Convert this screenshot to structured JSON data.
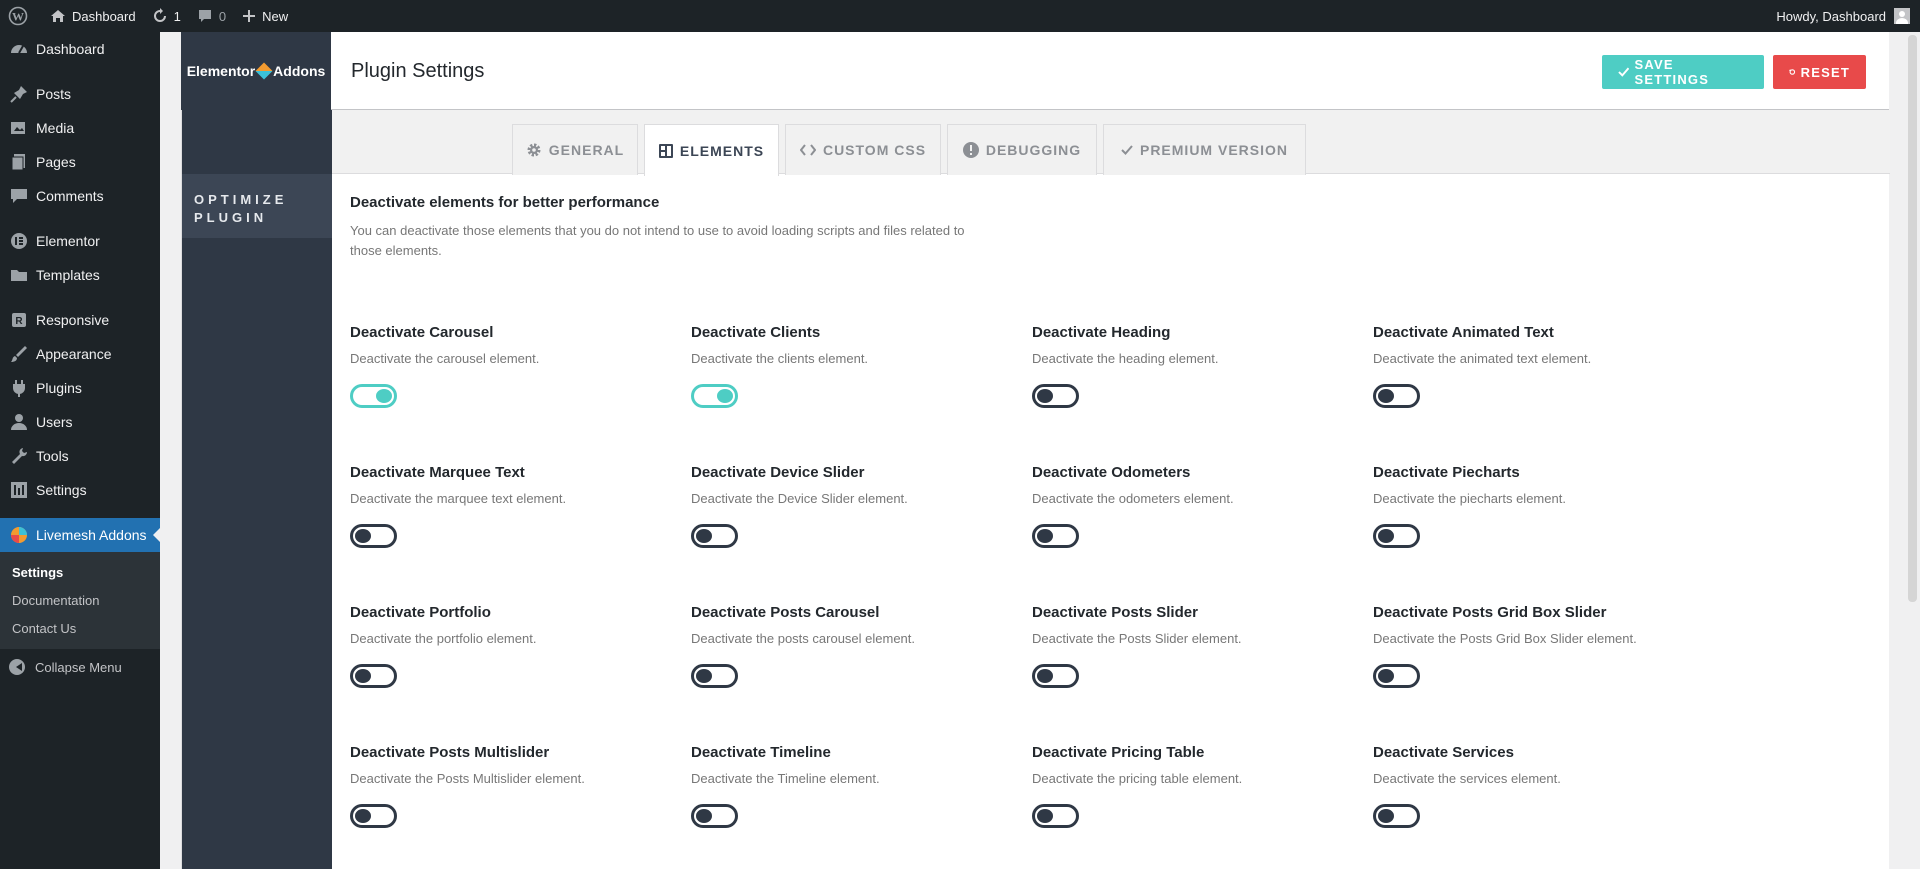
{
  "adminbar": {
    "site_name": "Dashboard",
    "updates_count": "1",
    "comments_count": "0",
    "new_label": "New",
    "howdy": "Howdy, Dashboard"
  },
  "menu": {
    "items": [
      {
        "label": "Dashboard",
        "icon": "dashboard-icon"
      },
      {
        "label": "Posts",
        "icon": "pin-icon"
      },
      {
        "label": "Media",
        "icon": "media-icon"
      },
      {
        "label": "Pages",
        "icon": "pages-icon"
      },
      {
        "label": "Comments",
        "icon": "comment-icon"
      },
      {
        "label": "Elementor",
        "icon": "elementor-icon"
      },
      {
        "label": "Templates",
        "icon": "folder-icon"
      },
      {
        "label": "Responsive",
        "icon": "responsive-icon"
      },
      {
        "label": "Appearance",
        "icon": "brush-icon"
      },
      {
        "label": "Plugins",
        "icon": "plug-icon"
      },
      {
        "label": "Users",
        "icon": "user-icon"
      },
      {
        "label": "Tools",
        "icon": "wrench-icon"
      },
      {
        "label": "Settings",
        "icon": "settings-icon"
      },
      {
        "label": "Livemesh Addons",
        "icon": "livemesh-icon"
      }
    ],
    "submenu": [
      "Settings",
      "Documentation",
      "Contact Us"
    ],
    "collapse": "Collapse Menu"
  },
  "header": {
    "logo_left": "Elementor",
    "logo_right": "Addons",
    "title": "Plugin Settings",
    "save_label": "SAVE SETTINGS",
    "reset_label": "RESET"
  },
  "sidebar": {
    "item_line1": "OPTIMIZE",
    "item_line2": "PLUGIN"
  },
  "tabs": [
    "GENERAL",
    "ELEMENTS",
    "CUSTOM CSS",
    "DEBUGGING",
    "PREMIUM VERSION"
  ],
  "section": {
    "title": "Deactivate elements for better performance",
    "desc": "You can deactivate those elements that you do not intend to use to avoid loading scripts and files related to those elements."
  },
  "elements": [
    {
      "title": "Deactivate Carousel",
      "desc": "Deactivate the carousel element.",
      "on": true
    },
    {
      "title": "Deactivate Clients",
      "desc": "Deactivate the clients element.",
      "on": true
    },
    {
      "title": "Deactivate Heading",
      "desc": "Deactivate the heading element.",
      "on": false
    },
    {
      "title": "Deactivate Animated Text",
      "desc": "Deactivate the animated text element.",
      "on": false
    },
    {
      "title": "Deactivate Marquee Text",
      "desc": "Deactivate the marquee text element.",
      "on": false
    },
    {
      "title": "Deactivate Device Slider",
      "desc": "Deactivate the Device Slider element.",
      "on": false
    },
    {
      "title": "Deactivate Odometers",
      "desc": "Deactivate the odometers element.",
      "on": false
    },
    {
      "title": "Deactivate Piecharts",
      "desc": "Deactivate the piecharts element.",
      "on": false
    },
    {
      "title": "Deactivate Portfolio",
      "desc": "Deactivate the portfolio element.",
      "on": false
    },
    {
      "title": "Deactivate Posts Carousel",
      "desc": "Deactivate the posts carousel element.",
      "on": false
    },
    {
      "title": "Deactivate Posts Slider",
      "desc": "Deactivate the Posts Slider element.",
      "on": false
    },
    {
      "title": "Deactivate Posts Grid Box Slider",
      "desc": "Deactivate the Posts Grid Box Slider element.",
      "on": false
    },
    {
      "title": "Deactivate Posts Multislider",
      "desc": "Deactivate the Posts Multislider element.",
      "on": false
    },
    {
      "title": "Deactivate Timeline",
      "desc": "Deactivate the Timeline element.",
      "on": false
    },
    {
      "title": "Deactivate Pricing Table",
      "desc": "Deactivate the pricing table element.",
      "on": false
    },
    {
      "title": "Deactivate Services",
      "desc": "Deactivate the services element.",
      "on": false
    }
  ]
}
